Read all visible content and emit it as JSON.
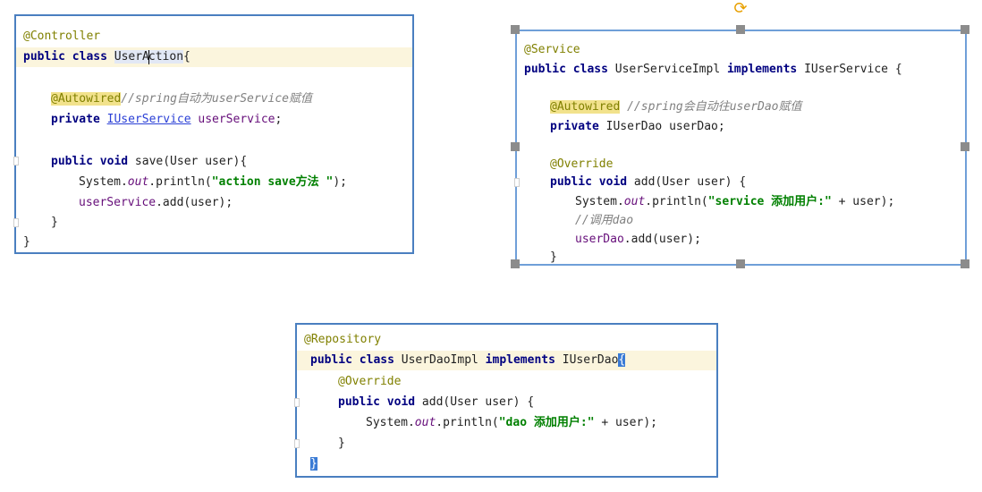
{
  "controller": {
    "annotation": "@Controller",
    "class_kw": "public class",
    "class_name_pre": "UserA",
    "class_name_post": "ction",
    "brace_open": "{",
    "autowired": "@Autowired",
    "autowired_comment": "//spring自动为userService赋值",
    "field_kw": "private",
    "field_type": "IUserService",
    "field_name": "userService",
    "semicolon": ";",
    "method_kw": "public void",
    "method_sig": "save(User user){",
    "println_prefix": "System.",
    "println_out": "out",
    "println_call": ".println(",
    "println_str": "\"action save方法 \"",
    "println_end": ");",
    "call_obj": "userService",
    "call_rest": ".add(user);",
    "close_method": "}",
    "close_class": "}"
  },
  "service": {
    "annotation": "@Service",
    "class_kw": "public class",
    "class_name": "UserServiceImpl",
    "implements_kw": "implements",
    "iface": "IUserService {",
    "autowired": "@Autowired",
    "autowired_comment": "//spring会自动往userDao赋值",
    "field_kw": "private",
    "field_decl": "IUserDao userDao;",
    "override": "@Override",
    "method_kw": "public void",
    "method_sig": "add(User user) {",
    "println_prefix": "System.",
    "println_out": "out",
    "println_call": ".println(",
    "println_str": "\"service 添加用户:\"",
    "println_end": " + user);",
    "comment2": "//调用dao",
    "call_obj": "userDao",
    "call_rest": ".add(user);",
    "close_method": "}"
  },
  "repository": {
    "annotation": "@Repository",
    "class_kw": "public class",
    "class_name": "UserDaoImpl",
    "implements_kw": "implements",
    "iface": "IUserDao",
    "brace_open": "{",
    "override": "@Override",
    "method_kw": "public void",
    "method_sig": "add(User user) {",
    "println_prefix": "System.",
    "println_out": "out",
    "println_call": ".println(",
    "println_str": "\"dao 添加用户:\"",
    "println_end": " + user);",
    "close_method": "}",
    "close_class": "}"
  }
}
